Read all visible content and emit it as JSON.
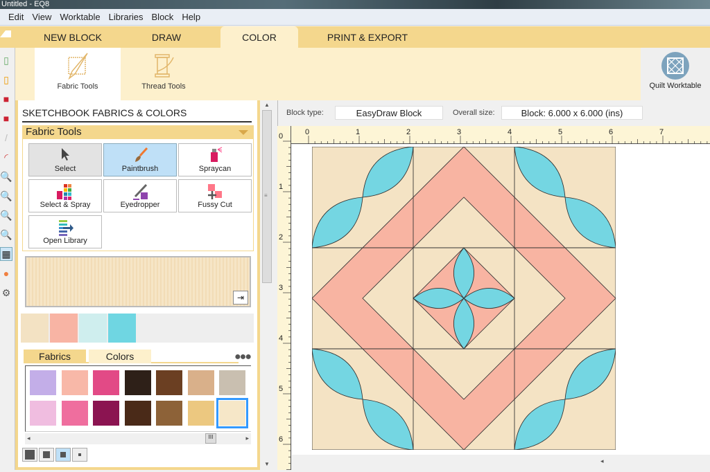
{
  "window": {
    "title": "Untitled - EQ8"
  },
  "menu": [
    "Edit",
    "View",
    "Worktable",
    "Libraries",
    "Block",
    "Help"
  ],
  "tabs": [
    {
      "label": "NEW BLOCK"
    },
    {
      "label": "DRAW"
    },
    {
      "label": "COLOR",
      "active": true
    },
    {
      "label": "PRINT & EXPORT"
    }
  ],
  "ribbon": {
    "fabric_tools": "Fabric Tools",
    "thread_tools": "Thread Tools",
    "quilt_worktable": "Quilt Worktable"
  },
  "panel": {
    "title": "SKETCHBOOK FABRICS & COLORS",
    "section": "Fabric Tools",
    "tools": [
      {
        "label": "Select",
        "icon": "cursor-icon",
        "state": "pressed"
      },
      {
        "label": "Paintbrush",
        "icon": "paintbrush-icon",
        "state": "selected"
      },
      {
        "label": "Spraycan",
        "icon": "spraycan-icon"
      },
      {
        "label": "Select & Spray",
        "icon": "select-spray-icon"
      },
      {
        "label": "Eyedropper",
        "icon": "eyedropper-icon"
      },
      {
        "label": "Fussy Cut",
        "icon": "fussy-cut-icon"
      },
      {
        "label": "Open Library",
        "icon": "open-library-icon"
      }
    ],
    "sketchbook_swatches": [
      "#f3e2c3",
      "#f8b4a4",
      "#cfeeee",
      "#6fd6e2"
    ],
    "library_tabs": {
      "fabrics": "Fabrics",
      "colors": "Colors",
      "active": "Fabrics"
    },
    "fabrics": [
      "#c3aee8",
      "#f8b8a8",
      "#e24a86",
      "#2e2018",
      "#6b3f22",
      "#d9b08a",
      "#c9bfb0",
      "#f0bde0",
      "#ef6e9e",
      "#8b1451",
      "#4a2a18",
      "#8d6238",
      "#ecc880",
      "#f6e7c8"
    ],
    "selected_fabric_index": 13,
    "swatch_sizes": 4,
    "selected_size_index": 2
  },
  "canvas": {
    "block_type_label": "Block type:",
    "block_type": "EasyDraw Block",
    "overall_size_label": "Overall size:",
    "overall_size": "Block: 6.000 x 6.000 (ins)",
    "ruler_labels": [
      "0",
      "1",
      "2",
      "3",
      "4",
      "5",
      "6",
      "7"
    ]
  },
  "colors": {
    "background_fabric": "#f4e3c4",
    "ring_fabric": "#f8b4a2",
    "petal_fabric": "#74d6e2",
    "accent": "#f4d78d",
    "ribbon": "#fdf0cc"
  }
}
